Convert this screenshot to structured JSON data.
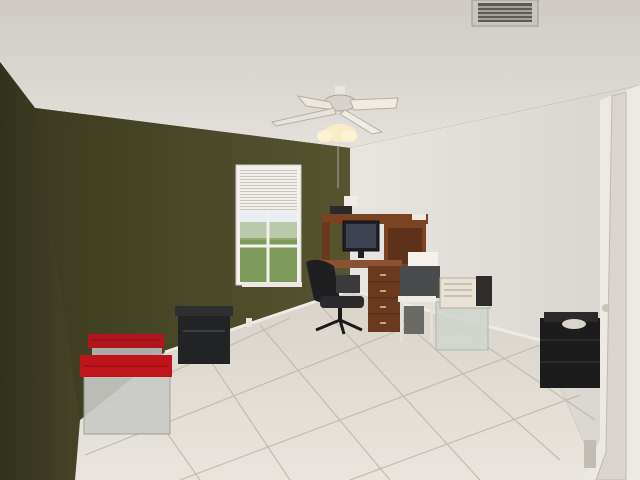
{
  "scene": {
    "kind": "photo",
    "room": "home office",
    "colors": {
      "ceiling": "#d9d6d0",
      "olive_wall": "#4b4a2a",
      "olive_wall_dark": "#3a391f",
      "white_wall": "#e6e3df",
      "floor_tile": "#e2ddd5",
      "grout": "#c6c0b6",
      "desk_wood": "#6b3a1e",
      "window_sky": "#e9eef2",
      "window_green": "#7e9a5a"
    },
    "objects": [
      {
        "name": "ceiling-fan",
        "icon": "ceiling-fan-icon"
      },
      {
        "name": "air-vent",
        "icon": "vent-icon"
      },
      {
        "name": "window-with-blinds",
        "icon": "window-icon"
      },
      {
        "name": "roll-top-desk",
        "icon": "desk-icon"
      },
      {
        "name": "computer-monitor",
        "icon": "monitor-icon"
      },
      {
        "name": "office-chair",
        "icon": "chair-icon"
      },
      {
        "name": "storage-bins",
        "icon": "bin-icon"
      },
      {
        "name": "black-tote",
        "icon": "tote-icon"
      },
      {
        "name": "side-table-with-drawers",
        "icon": "cabinet-icon"
      },
      {
        "name": "door-frame",
        "icon": "door-icon"
      }
    ]
  }
}
